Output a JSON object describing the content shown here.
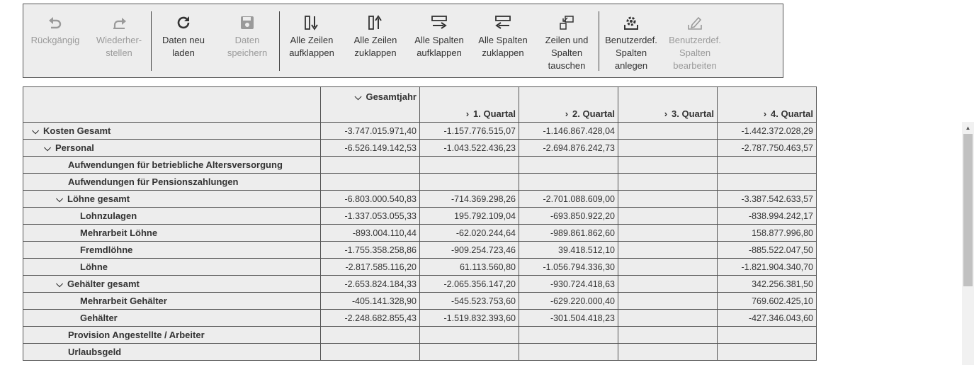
{
  "toolbar": {
    "groups": [
      [
        {
          "label": "Rückgängig",
          "icon": "undo-icon",
          "enabled": false
        },
        {
          "label": "Wiederher-\nstellen",
          "icon": "redo-icon",
          "enabled": false
        }
      ],
      [
        {
          "label": "Daten neu\nladen",
          "icon": "refresh-icon",
          "enabled": true
        },
        {
          "label": "Daten\nspeichern",
          "icon": "save-icon",
          "enabled": false
        }
      ],
      [
        {
          "label": "Alle Zeilen\naufklappen",
          "icon": "expand-rows-icon",
          "enabled": true
        },
        {
          "label": "Alle Zeilen\nzuklappen",
          "icon": "collapse-rows-icon",
          "enabled": true
        },
        {
          "label": "Alle Spalten\naufklappen",
          "icon": "expand-columns-icon",
          "enabled": true
        },
        {
          "label": "Alle Spalten\nzuklappen",
          "icon": "collapse-columns-icon",
          "enabled": true
        },
        {
          "label": "Zeilen und\nSpalten\ntauschen",
          "icon": "swap-icon",
          "enabled": true
        }
      ],
      [
        {
          "label": "Benutzerdef.\nSpalten\nanlegen",
          "icon": "custom-columns-icon",
          "enabled": true
        },
        {
          "label": "Benutzerdef.\nSpalten\nbearbeiten",
          "icon": "edit-columns-icon",
          "enabled": false
        }
      ]
    ]
  },
  "grid": {
    "header": {
      "gesamtjahr": "Gesamtjahr",
      "q1": "1. Quartal",
      "q2": "2. Quartal",
      "q3": "3. Quartal",
      "q4": "4. Quartal"
    },
    "rows": [
      {
        "label": "Kosten Gesamt",
        "level": 0,
        "expander": "open",
        "values": [
          "-3.747.015.971,40",
          "-1.157.776.515,07",
          "-1.146.867.428,04",
          "",
          "-1.442.372.028,29"
        ]
      },
      {
        "label": "Personal",
        "level": 1,
        "expander": "open",
        "values": [
          "-6.526.149.142,53",
          "-1.043.522.436,23",
          "-2.694.876.242,73",
          "",
          "-2.787.750.463,57"
        ]
      },
      {
        "label": "Aufwendungen für betriebliche Altersversorgung",
        "level": 2,
        "expander": "none",
        "values": [
          "",
          "",
          "",
          "",
          ""
        ]
      },
      {
        "label": "Aufwendungen für Pensionszahlungen",
        "level": 2,
        "expander": "none",
        "values": [
          "",
          "",
          "",
          "",
          ""
        ]
      },
      {
        "label": "Löhne gesamt",
        "level": 2,
        "expander": "open",
        "values": [
          "-6.803.000.540,83",
          "-714.369.298,26",
          "-2.701.088.609,00",
          "",
          "-3.387.542.633,57"
        ]
      },
      {
        "label": "Lohnzulagen",
        "level": 3,
        "expander": "none",
        "values": [
          "-1.337.053.055,33",
          "195.792.109,04",
          "-693.850.922,20",
          "",
          "-838.994.242,17"
        ]
      },
      {
        "label": "Mehrarbeit Löhne",
        "level": 3,
        "expander": "none",
        "values": [
          "-893.004.110,44",
          "-62.020.244,64",
          "-989.861.862,60",
          "",
          "158.877.996,80"
        ]
      },
      {
        "label": "Fremdlöhne",
        "level": 3,
        "expander": "none",
        "values": [
          "-1.755.358.258,86",
          "-909.254.723,46",
          "39.418.512,10",
          "",
          "-885.522.047,50"
        ]
      },
      {
        "label": "Löhne",
        "level": 3,
        "expander": "none",
        "values": [
          "-2.817.585.116,20",
          "61.113.560,80",
          "-1.056.794.336,30",
          "",
          "-1.821.904.340,70"
        ]
      },
      {
        "label": "Gehälter gesamt",
        "level": 2,
        "expander": "open",
        "values": [
          "-2.653.824.184,33",
          "-2.065.356.147,20",
          "-930.724.418,63",
          "",
          "342.256.381,50"
        ]
      },
      {
        "label": "Mehrarbeit Gehälter",
        "level": 3,
        "expander": "none",
        "values": [
          "-405.141.328,90",
          "-545.523.753,60",
          "-629.220.000,40",
          "",
          "769.602.425,10"
        ]
      },
      {
        "label": "Gehälter",
        "level": 3,
        "expander": "none",
        "values": [
          "-2.248.682.855,43",
          "-1.519.832.393,60",
          "-301.504.418,23",
          "",
          "-427.346.043,60"
        ]
      },
      {
        "label": "Provision Angestellte / Arbeiter",
        "level": 2,
        "expander": "none",
        "values": [
          "",
          "",
          "",
          "",
          ""
        ]
      },
      {
        "label": "Urlaubsgeld",
        "level": 2,
        "expander": "none",
        "values": [
          "",
          "",
          "",
          "",
          ""
        ]
      }
    ]
  }
}
